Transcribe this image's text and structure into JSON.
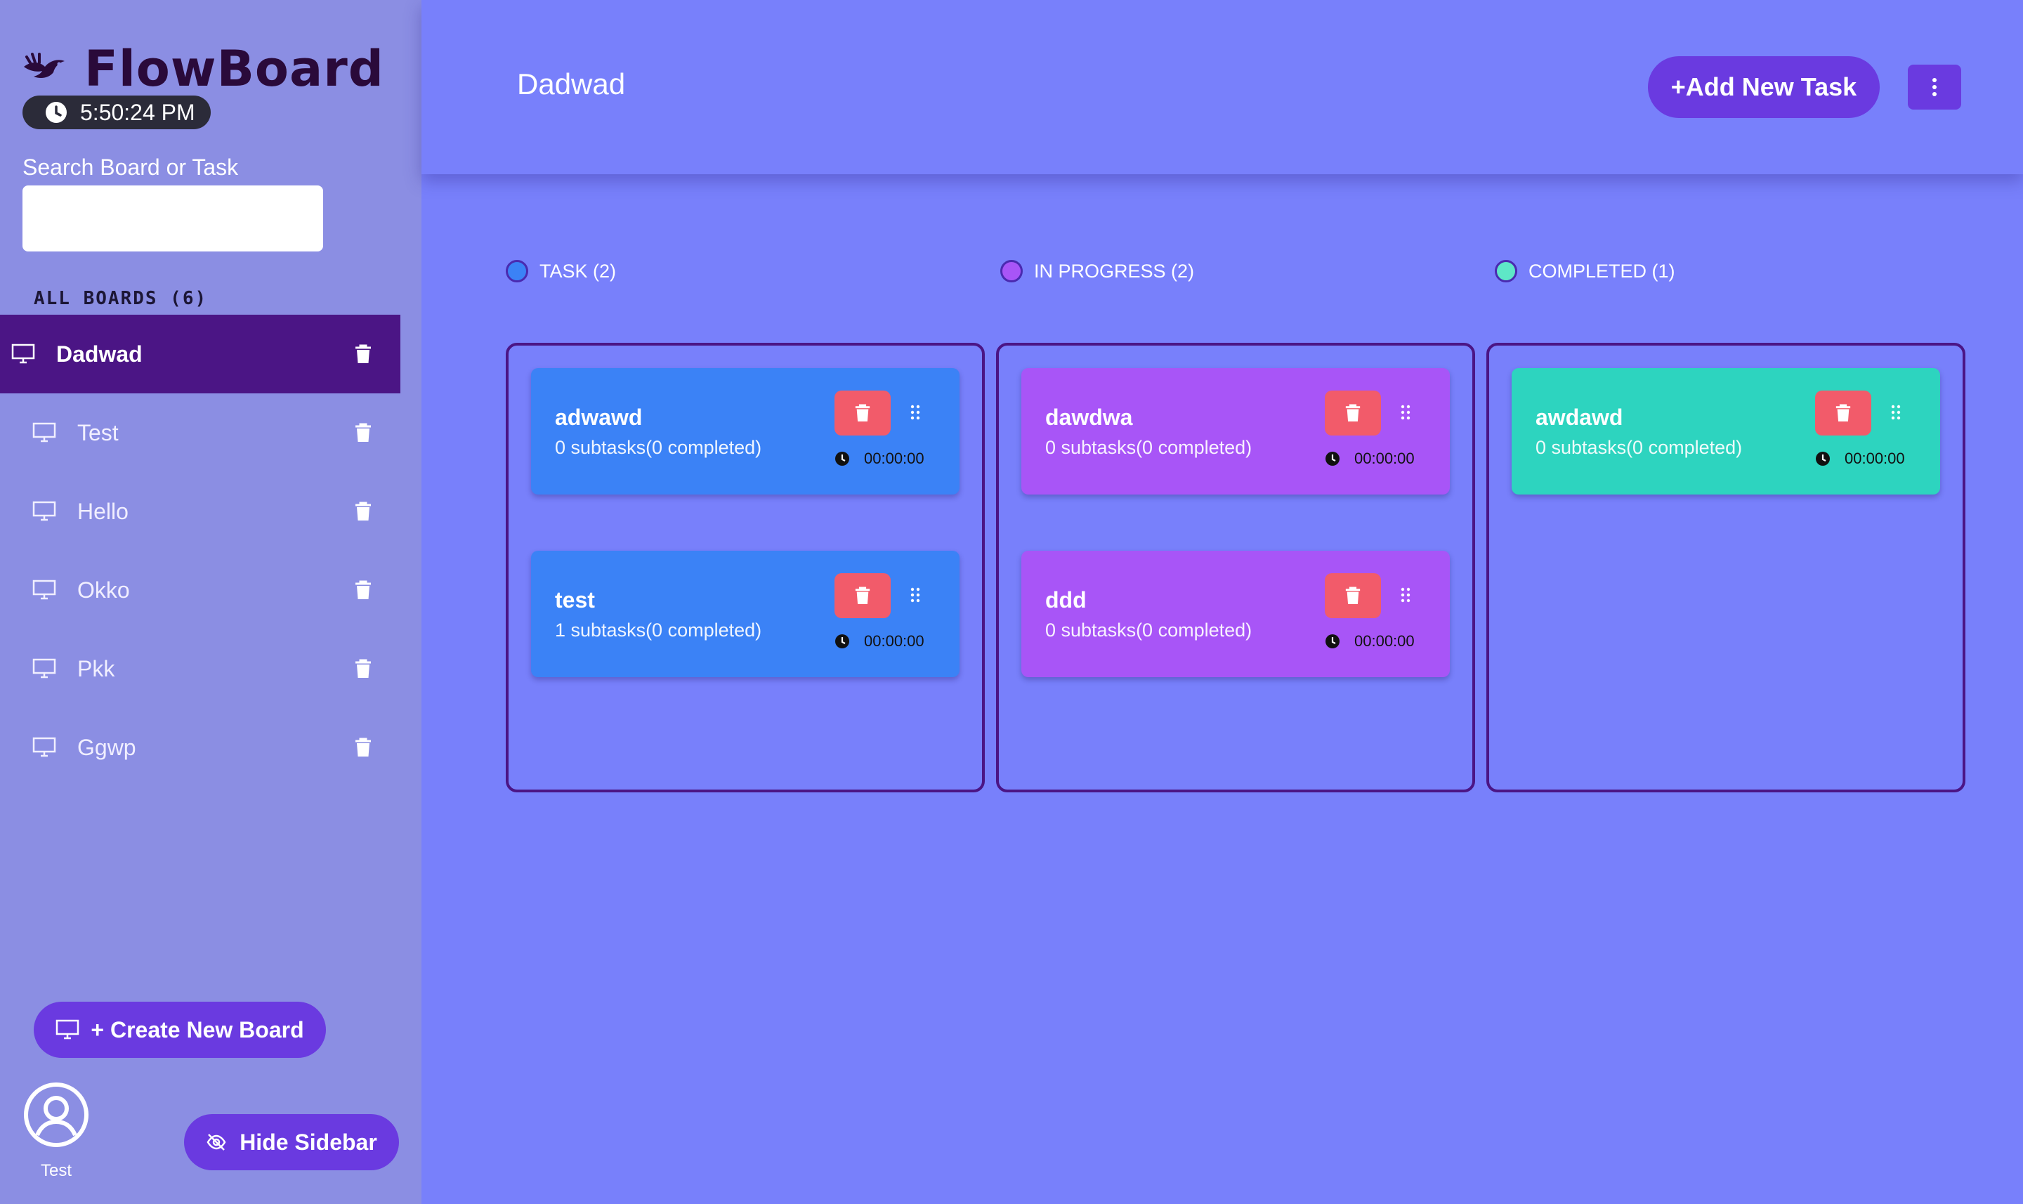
{
  "app": {
    "name": "FlowBoard",
    "clock": "5:50:24 PM"
  },
  "sidebar": {
    "search_label": "Search Board or Task",
    "search_value": "",
    "boards_heading": "ALL BOARDS (6)",
    "boards": [
      {
        "label": "Dadwad",
        "active": true
      },
      {
        "label": "Test",
        "active": false
      },
      {
        "label": "Hello",
        "active": false
      },
      {
        "label": "Okko",
        "active": false
      },
      {
        "label": "Pkk",
        "active": false
      },
      {
        "label": "Ggwp",
        "active": false
      }
    ],
    "create_label": "+ Create New Board",
    "hide_label": "Hide Sidebar",
    "user_name": "Test"
  },
  "header": {
    "board_title": "Dadwad",
    "add_task_label": "+Add New Task"
  },
  "columns": [
    {
      "label": "TASK (2)",
      "dot_color": "#3b82f6",
      "cards": [
        {
          "title": "adwawd",
          "subtasks": "0 subtasks(0 completed)",
          "timer": "00:00:00"
        },
        {
          "title": "test",
          "subtasks": "1 subtasks(0 completed)",
          "timer": "00:00:00"
        }
      ]
    },
    {
      "label": "IN PROGRESS (2)",
      "dot_color": "#a855f7",
      "cards": [
        {
          "title": "dawdwa",
          "subtasks": "0 subtasks(0 completed)",
          "timer": "00:00:00"
        },
        {
          "title": "ddd",
          "subtasks": "0 subtasks(0 completed)",
          "timer": "00:00:00"
        }
      ]
    },
    {
      "label": "COMPLETED (1)",
      "dot_color": "#5ee7c7",
      "cards": [
        {
          "title": "awdawd",
          "subtasks": "0 subtasks(0 completed)",
          "timer": "00:00:00"
        }
      ]
    }
  ],
  "colors": {
    "sidebar_bg": "#8b8ee3",
    "main_bg": "#7880fb",
    "accent": "#6a3ae0",
    "active_board": "#4b1585",
    "task_card": "#3b82f6",
    "in_progress_card": "#a855f7",
    "completed_card": "#2dd4bf",
    "delete_button": "#f25b6a"
  },
  "icons": {
    "logo": "bird-logo-icon",
    "clock": "clock-icon",
    "board": "monitor-icon",
    "delete": "trash-icon",
    "drag": "grip-icon",
    "menu": "kebab-menu-icon",
    "user": "user-circle-icon",
    "hide": "eye-slash-icon"
  }
}
